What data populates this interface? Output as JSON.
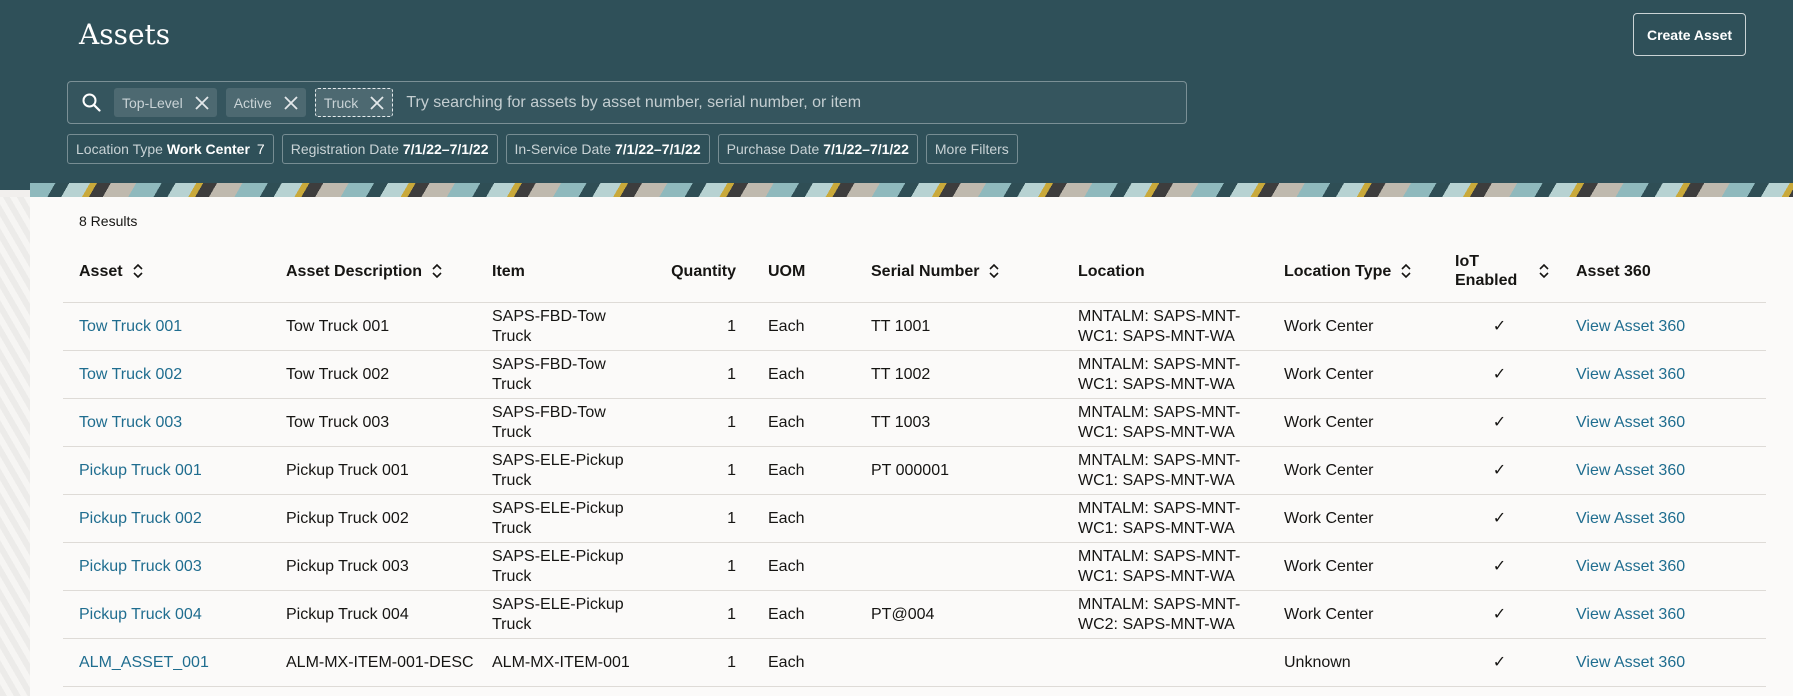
{
  "header": {
    "title": "Assets",
    "create_button": "Create Asset"
  },
  "search": {
    "placeholder": "Try searching for assets by asset number, serial number, or item",
    "chips": [
      "Top-Level",
      "Active",
      "Truck"
    ]
  },
  "filters": [
    {
      "label": "Location Type",
      "value": "Work Center",
      "count": "7"
    },
    {
      "label": "Registration Date",
      "value": "7/1/22–7/1/22"
    },
    {
      "label": "In-Service Date",
      "value": "7/1/22–7/1/22"
    },
    {
      "label": "Purchase Date",
      "value": "7/1/22–7/1/22"
    },
    {
      "label": "More Filters"
    }
  ],
  "results_label": "8 Results",
  "table": {
    "columns": [
      "Asset",
      "Asset Description",
      "Item",
      "Quantity",
      "UOM",
      "Serial Number",
      "Location",
      "Location Type",
      "IoT Enabled",
      "Asset 360"
    ],
    "rows": [
      {
        "asset": "Tow Truck 001",
        "description": "Tow Truck 001",
        "item": "SAPS-FBD-Tow Truck",
        "quantity": "1",
        "uom": "Each",
        "serial": "TT 1001",
        "location": "MNTALM: SAPS-MNT-WC1: SAPS-MNT-WA",
        "location_type": "Work Center",
        "iot": "✓",
        "asset360": "View Asset 360"
      },
      {
        "asset": "Tow Truck 002",
        "description": "Tow Truck 002",
        "item": "SAPS-FBD-Tow Truck",
        "quantity": "1",
        "uom": "Each",
        "serial": "TT 1002",
        "location": "MNTALM: SAPS-MNT-WC1: SAPS-MNT-WA",
        "location_type": "Work Center",
        "iot": "✓",
        "asset360": "View Asset 360"
      },
      {
        "asset": "Tow Truck 003",
        "description": "Tow Truck 003",
        "item": "SAPS-FBD-Tow Truck",
        "quantity": "1",
        "uom": "Each",
        "serial": "TT 1003",
        "location": "MNTALM: SAPS-MNT-WC1: SAPS-MNT-WA",
        "location_type": "Work Center",
        "iot": "✓",
        "asset360": "View Asset 360"
      },
      {
        "asset": "Pickup Truck 001",
        "description": "Pickup Truck 001",
        "item": "SAPS-ELE-Pickup Truck",
        "quantity": "1",
        "uom": "Each",
        "serial": "PT 000001",
        "location": "MNTALM: SAPS-MNT-WC1: SAPS-MNT-WA",
        "location_type": "Work Center",
        "iot": "✓",
        "asset360": "View Asset 360"
      },
      {
        "asset": "Pickup Truck 002",
        "description": "Pickup Truck 002",
        "item": "SAPS-ELE-Pickup Truck",
        "quantity": "1",
        "uom": "Each",
        "serial": "",
        "location": "MNTALM: SAPS-MNT-WC1: SAPS-MNT-WA",
        "location_type": "Work Center",
        "iot": "✓",
        "asset360": "View Asset 360"
      },
      {
        "asset": "Pickup Truck 003",
        "description": "Pickup Truck 003",
        "item": "SAPS-ELE-Pickup Truck",
        "quantity": "1",
        "uom": "Each",
        "serial": "",
        "location": "MNTALM: SAPS-MNT-WC1: SAPS-MNT-WA",
        "location_type": "Work Center",
        "iot": "✓",
        "asset360": "View Asset 360"
      },
      {
        "asset": "Pickup Truck 004",
        "description": "Pickup Truck 004",
        "item": "SAPS-ELE-Pickup Truck",
        "quantity": "1",
        "uom": "Each",
        "serial": "PT@004",
        "location": "MNTALM: SAPS-MNT-WC2: SAPS-MNT-WA",
        "location_type": "Work Center",
        "iot": "✓",
        "asset360": "View Asset 360"
      },
      {
        "asset": "ALM_ASSET_001",
        "description": "ALM-MX-ITEM-001-DESC",
        "item": "ALM-MX-ITEM-001",
        "quantity": "1",
        "uom": "Each",
        "serial": "",
        "location": "",
        "location_type": "Unknown",
        "iot": "✓",
        "asset360": "View Asset 360"
      }
    ]
  },
  "icons": {
    "search": "search-icon",
    "chip_remove": "close-icon",
    "sort": "sort-icon"
  },
  "colors": {
    "header_bg": "#2f5059",
    "link": "#1f6d8f",
    "content_bg": "#fbfaf9"
  }
}
